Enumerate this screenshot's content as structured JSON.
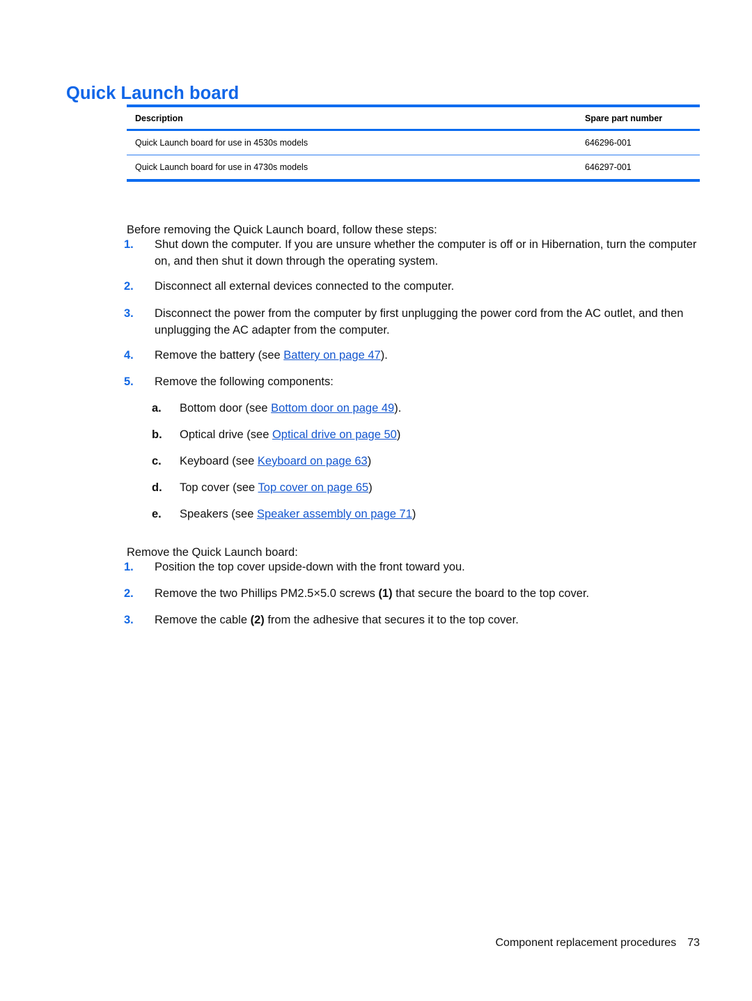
{
  "heading": "Quick Launch board",
  "table": {
    "headers": [
      "Description",
      "Spare part number"
    ],
    "rows": [
      {
        "description": "Quick Launch board for use in 4530s models",
        "spare_part_number": "646296-001"
      },
      {
        "description": "Quick Launch board for use in 4730s models",
        "spare_part_number": "646297-001"
      }
    ]
  },
  "colors": {
    "heading_blue": "#1066e8",
    "rule_blue": "#0b6cf0",
    "thin_rule_blue": "#2d7df0",
    "marker_blue": "#1368e4",
    "link_blue": "#1356cf"
  },
  "prereq": {
    "lead": "Before removing the Quick Launch board, follow these steps:",
    "steps": [
      {
        "marker": "1.",
        "text_before": "Shut down the computer. If you are unsure whether the computer is off or in Hibernation, turn the computer on, and then shut it down through the operating system.",
        "link": "",
        "text_after": ""
      },
      {
        "marker": "2.",
        "text_before": "Disconnect all external devices connected to the computer.",
        "link": "",
        "text_after": ""
      },
      {
        "marker": "3.",
        "text_before": "Disconnect the power from the computer by first unplugging the power cord from the AC outlet, and then unplugging the AC adapter from the computer.",
        "link": "",
        "text_after": ""
      },
      {
        "marker": "4.",
        "text_before": "Remove the battery (see ",
        "link": "Battery on page 47",
        "text_after": ")."
      },
      {
        "marker": "5.",
        "text_before": "Remove the following components:",
        "link": "",
        "text_after": ""
      }
    ],
    "subitems": [
      {
        "marker": "a.",
        "text_before": "Bottom door (see ",
        "link": "Bottom door on page 49",
        "text_after": ")."
      },
      {
        "marker": "b.",
        "text_before": "Optical drive (see ",
        "link": "Optical drive on page 50",
        "text_after": ")"
      },
      {
        "marker": "c.",
        "text_before": "Keyboard (see ",
        "link": "Keyboard on page 63",
        "text_after": ")"
      },
      {
        "marker": "d.",
        "text_before": "Top cover (see ",
        "link": "Top cover on page 65",
        "text_after": ")"
      },
      {
        "marker": "e.",
        "text_before": "Speakers (see ",
        "link": "Speaker assembly on page 71",
        "text_after": ")"
      }
    ]
  },
  "removal": {
    "lead": "Remove the Quick Launch board:",
    "steps": [
      {
        "marker": "1.",
        "text_before": "Position the top cover upside-down with the front toward you.",
        "callout": "",
        "text_after": ""
      },
      {
        "marker": "2.",
        "text_before": "Remove the two Phillips PM2.5×5.0 screws ",
        "callout": "(1)",
        "text_after": " that secure the board to the top cover."
      },
      {
        "marker": "3.",
        "text_before": "Remove the cable ",
        "callout": "(2)",
        "text_after": " from the adhesive that secures it to the top cover."
      }
    ]
  },
  "footer": {
    "title": "Component replacement procedures",
    "page_number": "73"
  }
}
